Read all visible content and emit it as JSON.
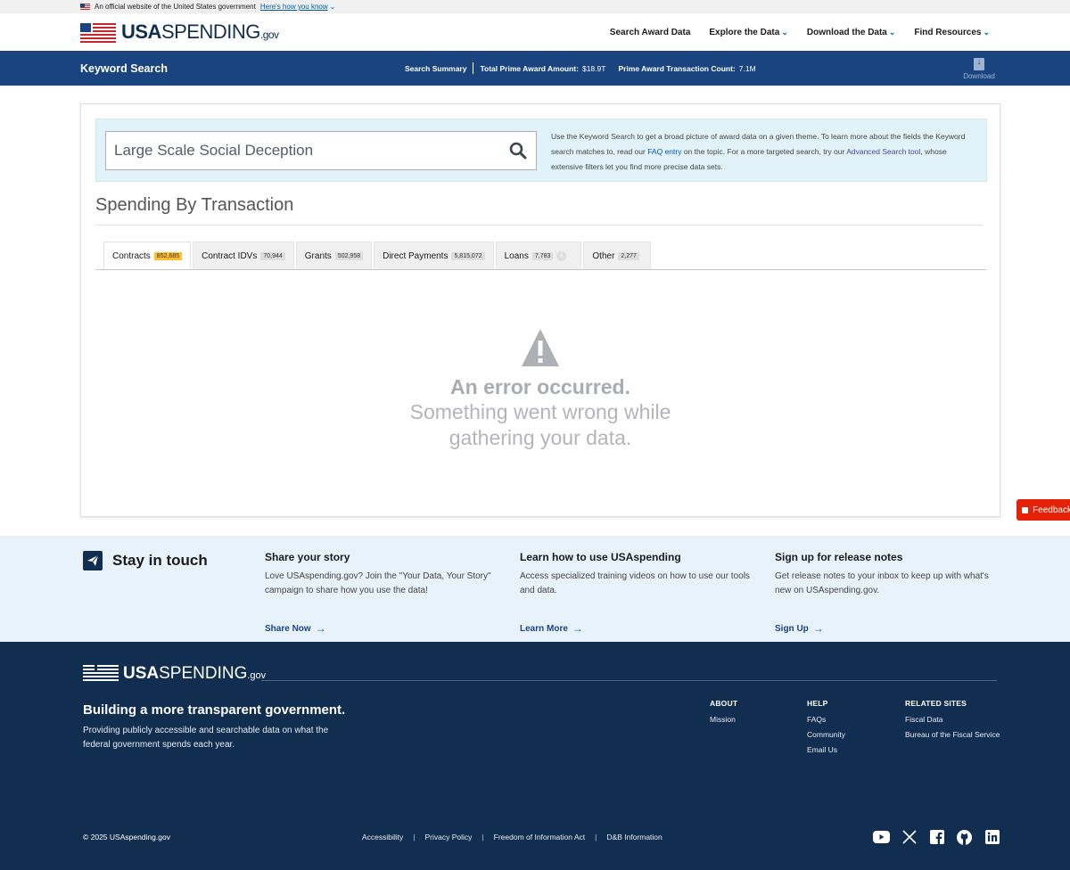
{
  "gov_banner": {
    "text": "An official website of the United States government",
    "link": "Here's how you know"
  },
  "header": {
    "logo": {
      "main": "USA",
      "light": "SPENDING",
      "suffix": ".gov"
    },
    "nav": [
      {
        "label": "Search Award Data",
        "dropdown": false
      },
      {
        "label": "Explore the Data",
        "dropdown": true
      },
      {
        "label": "Download the Data",
        "dropdown": true
      },
      {
        "label": "Find Resources",
        "dropdown": true
      }
    ]
  },
  "keyword_bar": {
    "title": "Keyword Search",
    "summary_label": "Search Summary",
    "total_amount_label": "Total Prime Award Amount:",
    "total_amount_value": "$18.9T",
    "transaction_count_label": "Prime Award Transaction Count:",
    "transaction_count_value": "7.1M",
    "download_label": "Download"
  },
  "search": {
    "value": "Large Scale Social Deception",
    "help": {
      "part1": "Use the Keyword Search to get a broad picture of award data on a given theme. To learn more about the fields the Keyword search matches to, read our ",
      "faq_link": "FAQ entry",
      "part2": " on the topic. For a more targeted search, try our ",
      "advanced_link": "Advanced Search tool",
      "part3": ", whose extensive filters let you find more precise data sets."
    }
  },
  "section_title": "Spending By Transaction",
  "tabs": [
    {
      "label": "Contracts",
      "count": "852,685",
      "active": true
    },
    {
      "label": "Contract IDVs",
      "count": "70,944"
    },
    {
      "label": "Grants",
      "count": "502,958"
    },
    {
      "label": "Direct Payments",
      "count": "5,815,072"
    },
    {
      "label": "Loans",
      "count": "7,783",
      "info": "i"
    },
    {
      "label": "Other",
      "count": "2,277"
    }
  ],
  "error": {
    "heading": "An error occurred.",
    "message_line1": "Something went wrong while",
    "message_line2": "gathering your data."
  },
  "feedback_label": "Feedback",
  "stay_in_touch": {
    "title": "Stay in touch",
    "columns": [
      {
        "heading": "Share your story",
        "text": "Love USAspending.gov? Join the \"Your Data, Your Story\" campaign to share how you use the data!",
        "cta": "Share Now"
      },
      {
        "heading": "Learn how to use USAspending",
        "text": "Access specialized training videos on how to use our tools and data.",
        "cta": "Learn More"
      },
      {
        "heading": "Sign up for release notes",
        "text": "Get release notes to your inbox to keep up with what's new on USAspending.gov.",
        "cta": "Sign Up"
      }
    ]
  },
  "footer": {
    "tagline": "Building a more transparent government.",
    "description": "Providing publicly accessible and searchable data on what the federal government spends each year.",
    "columns": [
      {
        "heading": "ABOUT",
        "items": [
          "Mission"
        ]
      },
      {
        "heading": "HELP",
        "items": [
          "FAQs",
          "Community",
          "Email Us"
        ]
      },
      {
        "heading": "RELATED SITES",
        "items": [
          "Fiscal Data",
          "Bureau of the Fiscal Service"
        ]
      }
    ],
    "copyright": "© 2025 USAspending.gov",
    "links": [
      "Accessibility",
      "Privacy Policy",
      "Freedom of Information Act",
      "D&B Information"
    ],
    "social": [
      "youtube-icon",
      "x-icon",
      "facebook-icon",
      "github-icon",
      "linkedin-icon"
    ]
  }
}
